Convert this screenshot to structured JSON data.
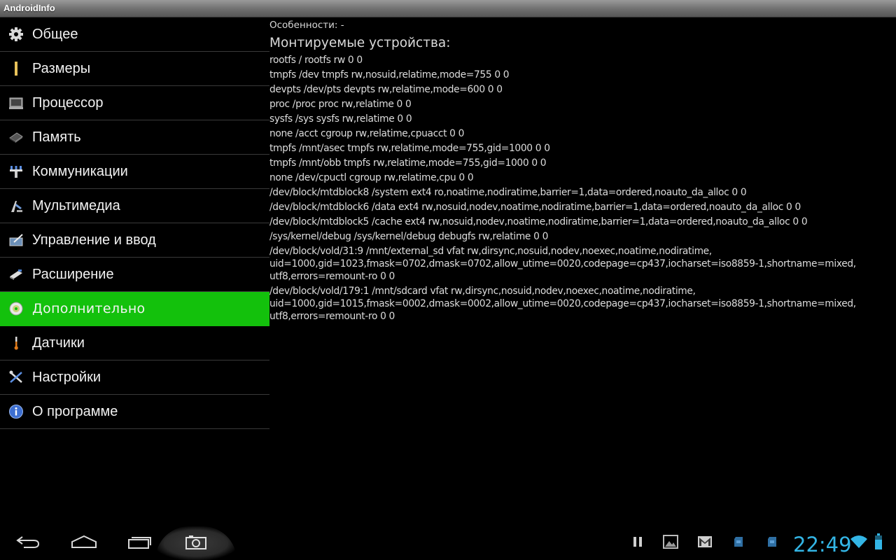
{
  "app": {
    "title": "AndroidInfo"
  },
  "sidebar": {
    "items": [
      {
        "label": "Общее",
        "icon": "gear-icon"
      },
      {
        "label": "Размеры",
        "icon": "ruler-icon"
      },
      {
        "label": "Процессор",
        "icon": "processor-icon"
      },
      {
        "label": "Память",
        "icon": "memory-chip-icon"
      },
      {
        "label": "Коммуникации",
        "icon": "antenna-icon"
      },
      {
        "label": "Мультимедиа",
        "icon": "multimedia-icon"
      },
      {
        "label": "Управление и ввод",
        "icon": "input-pen-icon"
      },
      {
        "label": "Расширение",
        "icon": "extension-icon"
      },
      {
        "label": "Дополнительно",
        "icon": "disc-icon",
        "selected": true
      },
      {
        "label": "Датчики",
        "icon": "thermometer-icon"
      },
      {
        "label": "Настройки",
        "icon": "tools-icon"
      },
      {
        "label": "О программе",
        "icon": "info-icon"
      }
    ]
  },
  "content": {
    "features_line": "Особенности: -",
    "mounts_title": "Монтируемые устройства:",
    "mounts": [
      "rootfs / rootfs rw 0 0",
      "tmpfs /dev tmpfs rw,nosuid,relatime,mode=755 0 0",
      "devpts /dev/pts devpts rw,relatime,mode=600 0 0",
      "proc /proc proc rw,relatime 0 0",
      "sysfs /sys sysfs rw,relatime 0 0",
      "none /acct cgroup rw,relatime,cpuacct 0 0",
      "tmpfs /mnt/asec tmpfs rw,relatime,mode=755,gid=1000 0 0",
      "tmpfs /mnt/obb tmpfs rw,relatime,mode=755,gid=1000 0 0",
      "none /dev/cpuctl cgroup rw,relatime,cpu 0 0",
      "/dev/block/mtdblock8 /system ext4 ro,noatime,nodiratime,barrier=1,data=ordered,noauto_da_alloc 0 0",
      "/dev/block/mtdblock6 /data ext4 rw,nosuid,nodev,noatime,nodiratime,barrier=1,data=ordered,noauto_da_alloc 0 0",
      "/dev/block/mtdblock5 /cache ext4 rw,nosuid,nodev,noatime,nodiratime,barrier=1,data=ordered,noauto_da_alloc 0 0",
      "/sys/kernel/debug /sys/kernel/debug debugfs rw,relatime 0 0",
      "/dev/block/vold/31:9 /mnt/external_sd vfat rw,dirsync,nosuid,nodev,noexec,noatime,nodiratime,\nuid=1000,gid=1023,fmask=0702,dmask=0702,allow_utime=0020,codepage=cp437,iocharset=iso8859-1,shortname=mixed,\nutf8,errors=remount-ro 0 0",
      "/dev/block/vold/179:1 /mnt/sdcard vfat rw,dirsync,nosuid,nodev,noexec,noatime,nodiratime,\nuid=1000,gid=1015,fmask=0002,dmask=0002,allow_utime=0020,codepage=cp437,iocharset=iso8859-1,shortname=mixed,\nutf8,errors=remount-ro 0 0"
    ]
  },
  "system_bar": {
    "clock": "22:49",
    "accent_color": "#33b5e5",
    "selected_color": "#13c10c",
    "buttons": [
      "back-icon",
      "home-icon",
      "recent-apps-icon",
      "screenshot-icon"
    ],
    "status_icons": [
      "pause-icon",
      "gallery-icon",
      "gmail-icon",
      "sd-card-icon",
      "sd-card-icon",
      "wifi-icon",
      "battery-icon"
    ]
  }
}
